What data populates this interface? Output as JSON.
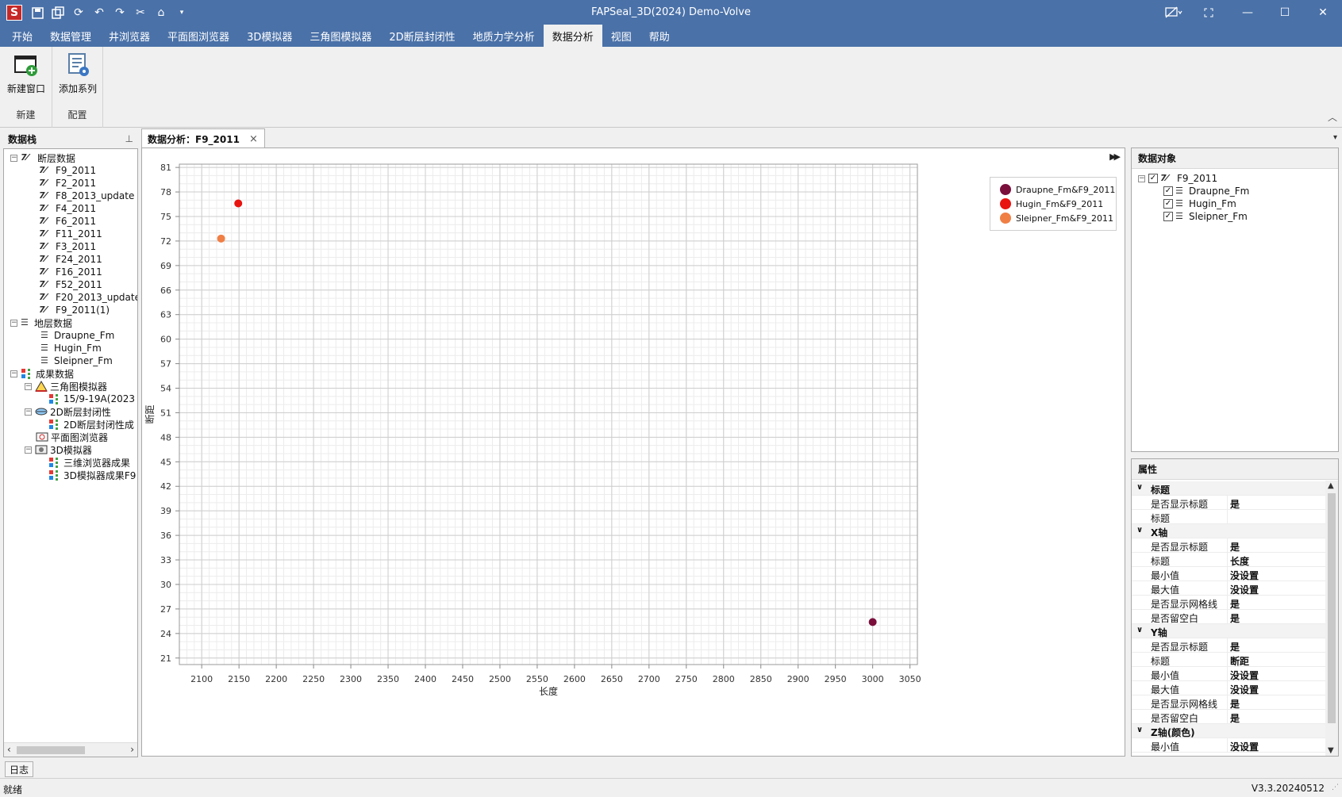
{
  "window": {
    "title": "FAPSeal_3D(2024) Demo-Volve",
    "logo_letter": "S"
  },
  "menu": {
    "tabs": [
      "开始",
      "数据管理",
      "井浏览器",
      "平面图浏览器",
      "3D模拟器",
      "三角图模拟器",
      "2D断层封闭性",
      "地质力学分析",
      "数据分析",
      "视图",
      "帮助"
    ],
    "active_index": 8
  },
  "ribbon": {
    "new_window_label": "新建窗口",
    "add_series_label": "添加系列",
    "group_new_label": "新建",
    "group_config_label": "配置"
  },
  "data_tree": {
    "title": "数据栈",
    "fault_root": "断层数据",
    "faults": [
      "F9_2011",
      "F2_2011",
      "F8_2013_update",
      "F4_2011",
      "F6_2011",
      "F11_2011",
      "F3_2011",
      "F24_2011",
      "F16_2011",
      "F52_2011",
      "F20_2013_update",
      "F9_2011(1)"
    ],
    "layer_root": "地层数据",
    "layers": [
      "Draupne_Fm",
      "Hugin_Fm",
      "Sleipner_Fm"
    ],
    "result_root": "成果数据",
    "triangle_sim": "三角图模拟器",
    "triangle_child": "15/9-19A(2023",
    "fault_seal_2d": "2D断层封闭性",
    "fault_seal_2d_child": "2D断层封闭性成",
    "map_browser": "平面图浏览器",
    "sim_3d": "3D模拟器",
    "sim_3d_child_1": "三维浏览器成果",
    "sim_3d_child_2": "3D模拟器成果F9"
  },
  "doc_tab": {
    "label": "数据分析：F9_2011",
    "close": "×"
  },
  "chart_data": {
    "type": "scatter",
    "title": "",
    "xlabel": "长度",
    "ylabel": "断距",
    "xlim": [
      2070,
      3060
    ],
    "ylim": [
      20.2,
      81.4
    ],
    "xticks": [
      2100,
      2150,
      2200,
      2250,
      2300,
      2350,
      2400,
      2450,
      2500,
      2550,
      2600,
      2650,
      2700,
      2750,
      2800,
      2850,
      2900,
      2950,
      3000,
      3050
    ],
    "yticks": [
      21,
      24,
      27,
      30,
      33,
      36,
      39,
      42,
      45,
      48,
      51,
      54,
      57,
      60,
      63,
      66,
      69,
      72,
      75,
      78,
      81
    ],
    "grid": true,
    "legend_position": "top-right",
    "series": [
      {
        "name": "Draupne_Fm&F9_2011",
        "color": "#7a0f3c",
        "points": [
          [
            3000,
            25.4
          ]
        ]
      },
      {
        "name": "Hugin_Fm&F9_2011",
        "color": "#e8130f",
        "points": [
          [
            2149,
            76.6
          ]
        ]
      },
      {
        "name": "Sleipner_Fm&F9_2011",
        "color": "#f07f45",
        "points": [
          [
            2126,
            72.3
          ]
        ]
      }
    ]
  },
  "objects_panel": {
    "title": "数据对象",
    "root": "F9_2011",
    "children": [
      "Draupne_Fm",
      "Hugin_Fm",
      "Sleipner_Fm"
    ]
  },
  "properties": {
    "title": "属性",
    "cat_title": "标题",
    "cat_x": "X轴",
    "cat_y": "Y轴",
    "cat_z": "Z轴(颜色)",
    "show_title_key": "是否显示标题",
    "title_key": "标题",
    "min_key": "最小值",
    "max_key": "最大值",
    "show_grid_key": "是否显示网格线",
    "margin_key": "是否留空白",
    "yes": "是",
    "not_set": "没设置",
    "x_title_value": "长度",
    "y_title_value": "断距"
  },
  "bottom": {
    "log_tab": "日志",
    "status": "就绪",
    "version": "V3.3.20240512"
  },
  "colors": {
    "titlebar": "#4a71a8",
    "accent": "#4a71a8"
  }
}
